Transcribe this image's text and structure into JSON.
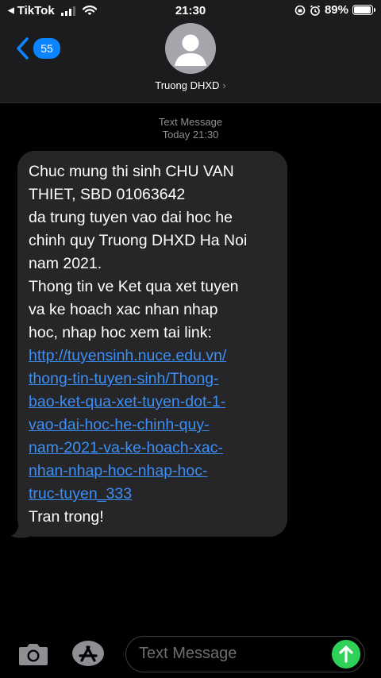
{
  "status_bar": {
    "back_app": "TikTok",
    "time": "21:30",
    "battery": "89%",
    "battery_level": 0.89
  },
  "nav": {
    "back_count": "55",
    "contact_name": "Truong DHXD",
    "contact_chevron": "›"
  },
  "conversation": {
    "service_label": "Text Message",
    "timestamp": "Today 21:30",
    "message_lines": [
      "Chuc mung thi sinh CHU VAN",
      "THIET, SBD 01063642",
      "da trung tuyen vao dai hoc he",
      "chinh quy Truong DHXD Ha Noi",
      "nam 2021.",
      "Thong tin ve Ket qua xet tuyen",
      "va ke hoach xac nhan nhap",
      "hoc, nhap hoc xem tai link:"
    ],
    "link_lines": [
      "http://tuyensinh.nuce.edu.vn/",
      "thong-tin-tuyen-sinh/Thong-",
      "bao-ket-qua-xet-tuyen-dot-1-",
      "vao-dai-hoc-he-chinh-quy-",
      "nam-2021-va-ke-hoach-xac-",
      "nhan-nhap-hoc-nhap-hoc-",
      "truc-tuyen_333"
    ],
    "closing": "Tran trong!"
  },
  "input": {
    "placeholder": "Text Message"
  },
  "icons": {
    "camera": "camera-icon",
    "appstore": "app-store-icon",
    "send": "send-arrow-icon"
  },
  "colors": {
    "header_bg": "#1c1c1e",
    "bubble_bg": "#262628",
    "link": "#3b8ff7",
    "accent_blue": "#0a84ff",
    "send_green": "#30d158"
  }
}
